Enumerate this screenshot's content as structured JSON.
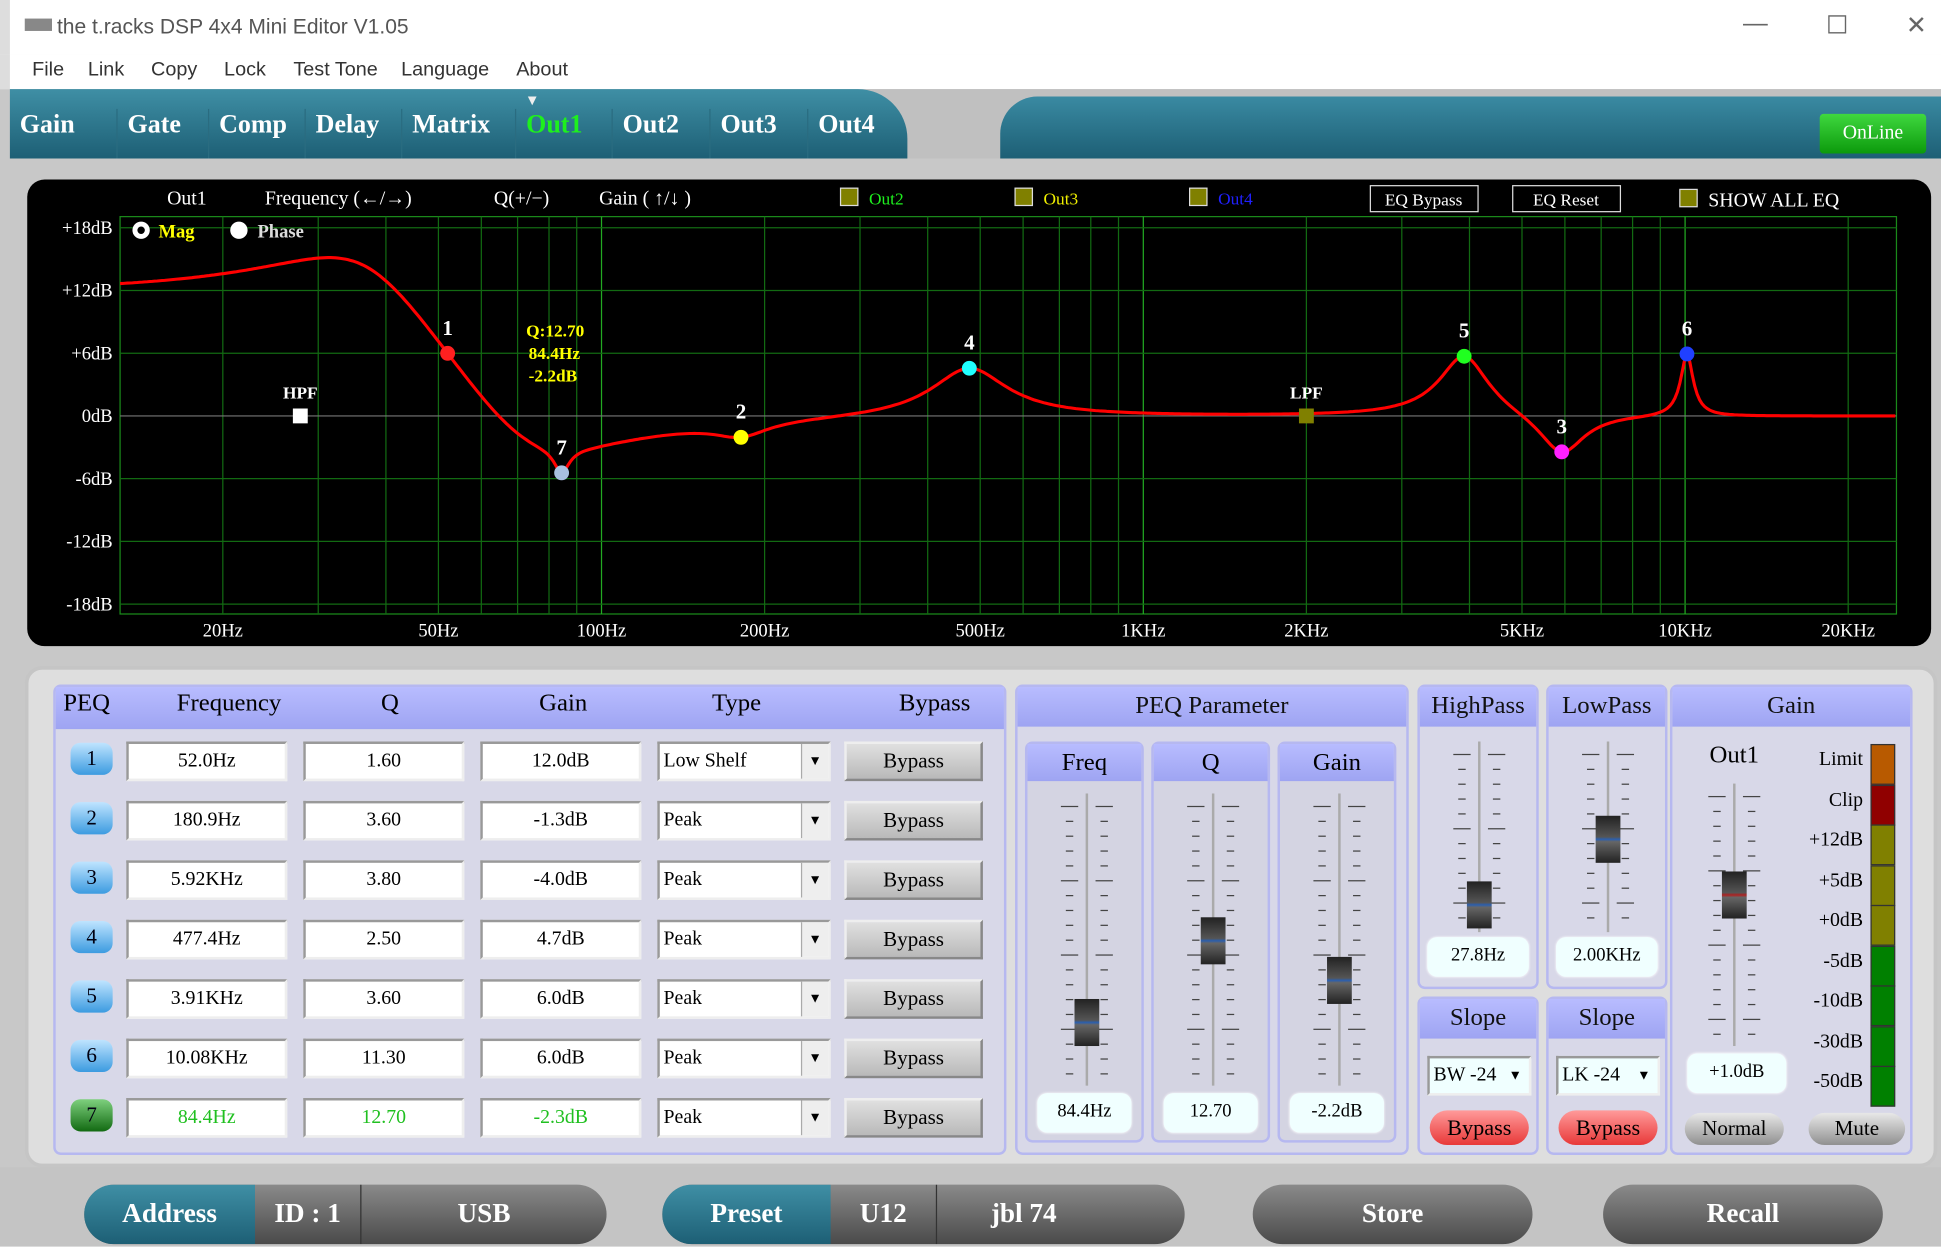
{
  "window": {
    "title": "the t.racks DSP 4x4 Mini Editor V1.05",
    "minimize": "—",
    "maximize": "☐",
    "close": "✕"
  },
  "menu": [
    "File",
    "Link",
    "Copy",
    "Lock",
    "Test Tone",
    "Language",
    "About"
  ],
  "tabs": [
    {
      "label": "Gain"
    },
    {
      "label": "Gate"
    },
    {
      "label": "Comp"
    },
    {
      "label": "Delay"
    },
    {
      "label": "Matrix"
    },
    {
      "label": "Out1",
      "active": true
    },
    {
      "label": "Out2"
    },
    {
      "label": "Out3"
    },
    {
      "label": "Out4"
    }
  ],
  "status": {
    "online": "OnLine"
  },
  "eq_header": {
    "channel": "Out1",
    "freq_hint": "Frequency (←/→)",
    "q_hint": "Q(+/−)",
    "gain_hint": "Gain ( ↑/↓ )",
    "overlays": [
      {
        "label": "Out2",
        "color": "#1ef01e"
      },
      {
        "label": "Out3",
        "color": "#f0f000"
      },
      {
        "label": "Out4",
        "color": "#2020ff"
      }
    ],
    "eq_bypass": "EQ Bypass",
    "eq_reset": "EQ Reset",
    "show_all": "SHOW ALL EQ",
    "mag": "Mag",
    "phase": "Phase",
    "view": "Mag"
  },
  "chart_data": {
    "type": "line",
    "x_scale": "log",
    "xlim": [
      20,
      20000
    ],
    "ylim": [
      -18,
      18
    ],
    "y_ticks": [
      "+18dB",
      "+12dB",
      "+6dB",
      "0dB",
      "-6dB",
      "-12dB",
      "-18dB"
    ],
    "y_values": [
      18,
      12,
      6,
      0,
      -6,
      -12,
      -18
    ],
    "x_ticks": [
      "20Hz",
      "50Hz",
      "100Hz",
      "200Hz",
      "500Hz",
      "1KHz",
      "2KHz",
      "5KHz",
      "10KHz",
      "20KHz"
    ],
    "x_values": [
      20,
      50,
      100,
      200,
      500,
      1000,
      2000,
      5000,
      10000,
      20000
    ],
    "curve_color": "#ff0000",
    "grid": true,
    "points": [
      {
        "label": "1",
        "freq": 52,
        "gain": 12,
        "q": 1.6,
        "type": "lowshelf",
        "color": "#ff2020"
      },
      {
        "label": "2",
        "freq": 180.9,
        "gain": -1.3,
        "q": 3.6,
        "type": "peak",
        "color": "#ffff00"
      },
      {
        "label": "3",
        "freq": 5920,
        "gain": -4,
        "q": 3.8,
        "type": "peak",
        "color": "#ff20ff"
      },
      {
        "label": "4",
        "freq": 477.4,
        "gain": 4.7,
        "q": 2.5,
        "type": "peak",
        "color": "#20ffff"
      },
      {
        "label": "5",
        "freq": 3910,
        "gain": 6,
        "q": 3.6,
        "type": "peak",
        "color": "#20ff20"
      },
      {
        "label": "6",
        "freq": 10080,
        "gain": 6,
        "q": 11.3,
        "type": "peak",
        "color": "#2040ff"
      },
      {
        "label": "7",
        "freq": 84.4,
        "gain": -2.3,
        "q": 12.7,
        "type": "peak",
        "color": "#a8c0e0"
      }
    ],
    "hpf": {
      "label": "HPF",
      "freq": 27.8,
      "color": "#ffffff"
    },
    "lpf": {
      "label": "LPF",
      "freq": 2000,
      "color": "#808000"
    },
    "tooltip": [
      "Q:12.70",
      "84.4Hz",
      "-2.2dB"
    ]
  },
  "peq": {
    "headers": [
      "PEQ",
      "Frequency",
      "Q",
      "Gain",
      "Type",
      "Bypass"
    ],
    "rows": [
      {
        "n": "1",
        "freq": "52.0Hz",
        "q": "1.60",
        "gain": "12.0dB",
        "type": "Low Shelf",
        "bypass": "Bypass"
      },
      {
        "n": "2",
        "freq": "180.9Hz",
        "q": "3.60",
        "gain": "-1.3dB",
        "type": "Peak",
        "bypass": "Bypass"
      },
      {
        "n": "3",
        "freq": "5.92KHz",
        "q": "3.80",
        "gain": "-4.0dB",
        "type": "Peak",
        "bypass": "Bypass"
      },
      {
        "n": "4",
        "freq": "477.4Hz",
        "q": "2.50",
        "gain": "4.7dB",
        "type": "Peak",
        "bypass": "Bypass"
      },
      {
        "n": "5",
        "freq": "3.91KHz",
        "q": "3.60",
        "gain": "6.0dB",
        "type": "Peak",
        "bypass": "Bypass"
      },
      {
        "n": "6",
        "freq": "10.08KHz",
        "q": "11.30",
        "gain": "6.0dB",
        "type": "Peak",
        "bypass": "Bypass"
      },
      {
        "n": "7",
        "freq": "84.4Hz",
        "q": "12.70",
        "gain": "-2.3dB",
        "type": "Peak",
        "bypass": "Bypass",
        "selected": true
      }
    ]
  },
  "peq_param": {
    "title": "PEQ Parameter",
    "freq": {
      "label": "Freq",
      "value": "84.4Hz",
      "level": 0.26
    },
    "q": {
      "label": "Q",
      "value": "12.70",
      "level": 0.59
    },
    "gain": {
      "label": "Gain",
      "value": "-2.2dB",
      "level": 0.43
    }
  },
  "highpass": {
    "title": "HighPass",
    "value": "27.8Hz",
    "level": 0.19,
    "slope_title": "Slope",
    "slope": "BW -24",
    "bypass": "Bypass"
  },
  "lowpass": {
    "title": "LowPass",
    "value": "2.00KHz",
    "level": 0.65,
    "slope_title": "Slope",
    "slope": "LK -24",
    "bypass": "Bypass"
  },
  "gain": {
    "title": "Gain",
    "channel": "Out1",
    "value": "+1.0dB",
    "level": 0.7,
    "normal": "Normal",
    "mute": "Mute",
    "meter_labels": [
      "Limit",
      "Clip",
      "+12dB",
      "+5dB",
      "+0dB",
      "-5dB",
      "-10dB",
      "-30dB",
      "-50dB"
    ],
    "meter_colors": [
      "#b85a00",
      "#900000",
      "#808000",
      "#808000",
      "#808000",
      "#008000",
      "#008000",
      "#008000",
      "#008000"
    ]
  },
  "bottom": {
    "address": "Address",
    "id": "ID : 1",
    "usb": "USB",
    "preset": "Preset",
    "preset_id": "U12",
    "preset_name": "jbl 74",
    "store": "Store",
    "recall": "Recall"
  }
}
